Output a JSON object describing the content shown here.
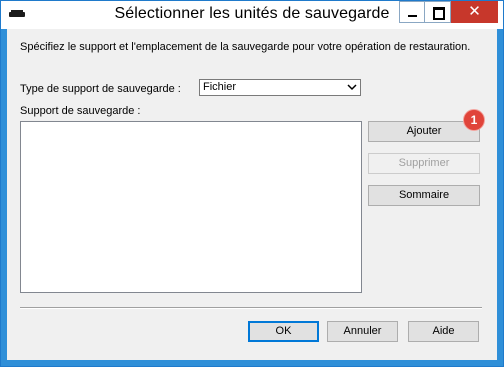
{
  "window": {
    "title": "Sélectionner les unités de sauvegarde",
    "close_glyph": "✕",
    "icons": [
      "app-icon",
      "minimize-icon",
      "maximize-icon",
      "close-icon"
    ]
  },
  "dialog": {
    "description": "Spécifiez le support et l'emplacement de la sauvegarde pour votre opération de restauration.",
    "media_type_label": "Type de support de sauvegarde :",
    "media_type_value": "Fichier",
    "media_label": "Support de sauvegarde :",
    "media_items": [],
    "buttons": {
      "add": "Ajouter",
      "remove": "Supprimer",
      "summary": "Sommaire",
      "ok": "OK",
      "cancel": "Annuler",
      "help": "Aide"
    },
    "step_badge": "1"
  },
  "colors": {
    "window_border": "#1f7acb",
    "close_button": "#c7372b",
    "default_button_border": "#0078d7",
    "badge": "#e0443a"
  }
}
